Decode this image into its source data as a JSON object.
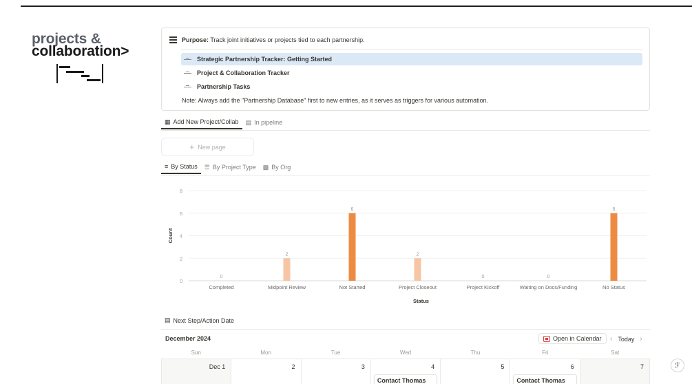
{
  "brand": {
    "line1": "projects &",
    "line2": "collaboration>"
  },
  "callout": {
    "purpose_label": "Purpose:",
    "purpose_text": "Track joint initiatives or projects tied to each partnership.",
    "links": [
      "Strategic Partnership Tracker: Getting Started",
      "Project & Collaboration Tracker",
      "Partnership Tasks"
    ],
    "note": "Note: Always add the \"Partnership Database\" first to new entries, as it serves as triggers for various automation."
  },
  "view_tabs": [
    {
      "label": "Add New Project/Collab",
      "icon": "gallery-icon"
    },
    {
      "label": "In pipeline",
      "icon": "table-icon"
    }
  ],
  "new_page_label": "New page",
  "chart_tabs": [
    {
      "label": "By Status",
      "icon": "stack-icon"
    },
    {
      "label": "By Project Type",
      "icon": "list-icon"
    },
    {
      "label": "By Org",
      "icon": "bar-chart-icon"
    }
  ],
  "chart_data": {
    "type": "bar",
    "categories": [
      "Completed",
      "Midpoint Review",
      "Not Started",
      "Project Closeout",
      "Project Kickoff",
      "Waiting on Docs/Funding",
      "No Status"
    ],
    "values": [
      0,
      2,
      6,
      2,
      0,
      0,
      6
    ],
    "colors": [
      "#f6c6a4",
      "#f6c6a4",
      "#ee8b43",
      "#f6c6a4",
      "#f6c6a4",
      "#f6c6a4",
      "#ee8b43"
    ],
    "xlabel": "Status",
    "ylabel": "Count",
    "ylim": [
      0,
      8
    ],
    "yticks": [
      0,
      2,
      4,
      6,
      8
    ],
    "grid": true
  },
  "calendar": {
    "section_title": "Next Step/Action Date",
    "month": "December 2024",
    "open_label": "Open in Calendar",
    "today_label": "Today",
    "weekdays": [
      "Sun",
      "Mon",
      "Tue",
      "Wed",
      "Thu",
      "Fri",
      "Sat"
    ],
    "days": [
      "Dec 1",
      "2",
      "3",
      "4",
      "5",
      "6",
      "7"
    ],
    "events": {
      "wed": "Contact Thomas",
      "fri": "Contact Thomas"
    }
  }
}
